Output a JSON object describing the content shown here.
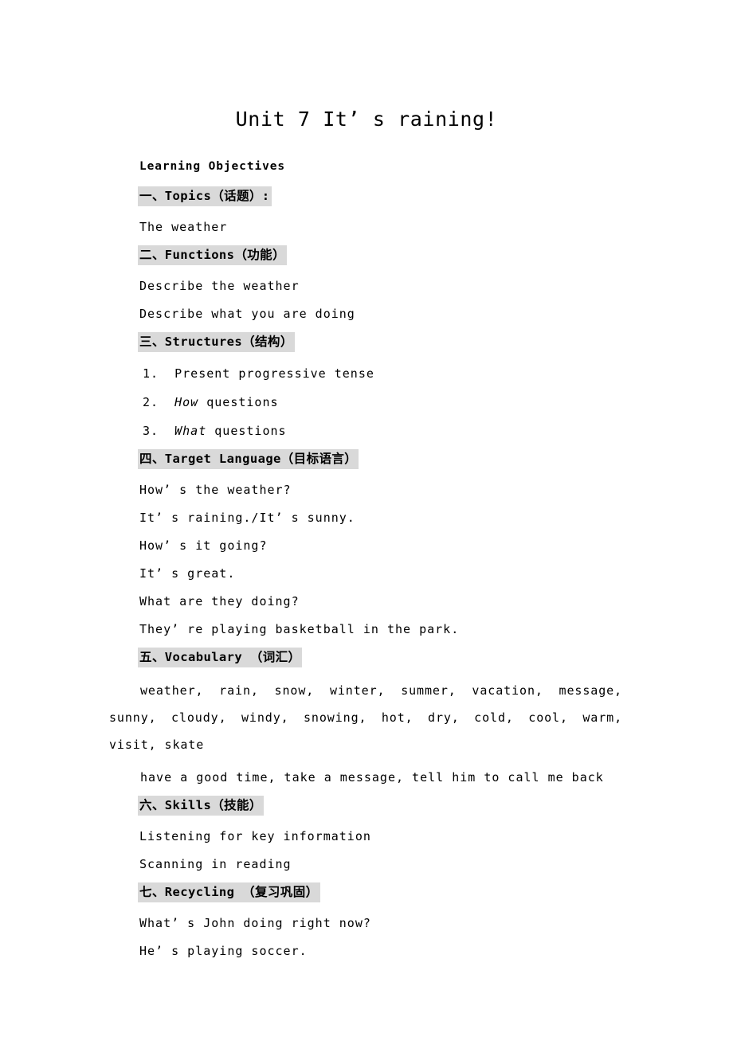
{
  "document": {
    "title": "Unit 7 It’ s raining!",
    "subtitle": "Learning Objectives",
    "highlight_color": "#d9d9d9",
    "page_background": "#ffffff",
    "text_color": "#000000"
  },
  "sections": [
    {
      "heading": "一、Topics（话题）:",
      "lines": [
        "The weather"
      ]
    },
    {
      "heading": "二、Functions（功能）",
      "lines": [
        "Describe the weather",
        "Describe what you are doing"
      ]
    },
    {
      "heading": "三、Structures（结构）",
      "list": [
        {
          "number": "1.",
          "italic": "",
          "text": "Present progressive tense"
        },
        {
          "number": "2.",
          "italic": "How",
          "text": " questions"
        },
        {
          "number": "3.",
          "italic": "What",
          "text": " questions"
        }
      ]
    },
    {
      "heading": "四、Target Language（目标语言）",
      "lines": [
        "How’ s the weather?",
        "It’ s raining./It’ s sunny.",
        "How’ s it going?",
        "It’ s great.",
        "What are they doing?",
        "They’ re playing basketball in the park."
      ]
    },
    {
      "heading": "五、Vocabulary （词汇）",
      "vocabulary_words": "weather, rain, snow, winter, summer, vacation, message, sunny, cloudy, windy, snowing, hot, dry, cold, cool, warm, visit, skate",
      "vocabulary_phrases": "have a good time, take a message, tell him to call me back"
    },
    {
      "heading": "六、Skills（技能）",
      "lines": [
        "Listening for key information",
        "Scanning in reading"
      ]
    },
    {
      "heading": "七、Recycling （复习巩固）",
      "lines": [
        "What’ s John doing right now?",
        "He’ s playing soccer."
      ]
    }
  ]
}
